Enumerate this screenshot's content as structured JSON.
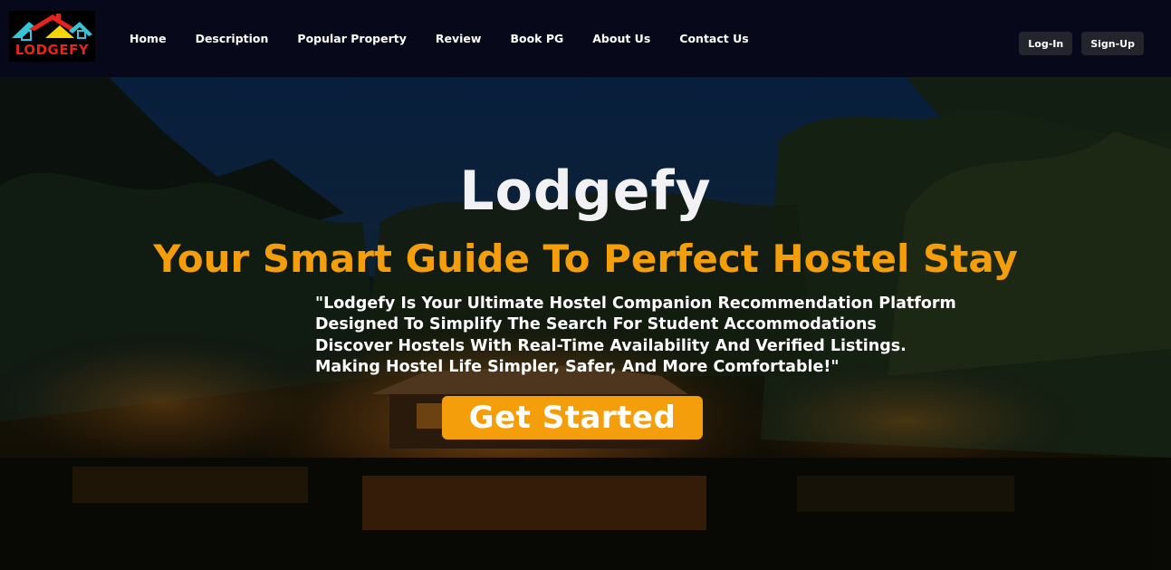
{
  "brand": {
    "logo_text": "LODGEFY",
    "colors": {
      "accent": "#f59e0b",
      "logo_red": "#e8221c",
      "navbar_bg": "#07081a",
      "button_dark": "#24252c"
    }
  },
  "nav": {
    "items": [
      {
        "label": "Home"
      },
      {
        "label": "Description"
      },
      {
        "label": "Popular Property"
      },
      {
        "label": "Review"
      },
      {
        "label": "Book PG"
      },
      {
        "label": "About Us"
      },
      {
        "label": "Contact Us"
      }
    ],
    "login_label": "Log-In",
    "signup_label": "Sign-Up"
  },
  "hero": {
    "title": "Lodgefy",
    "subtitle": "Your Smart Guide To Perfect Hostel Stay",
    "description_lines": [
      "\"Lodgefy Is Your Ultimate Hostel Companion Recommendation Platform",
      "Designed To Simplify The Search For Student Accommodations",
      "Discover Hostels With Real-Time Availability And Verified Listings.",
      "Making Hostel Life Simpler, Safer, And More Comfortable!\""
    ],
    "cta_label": "Get Started"
  }
}
